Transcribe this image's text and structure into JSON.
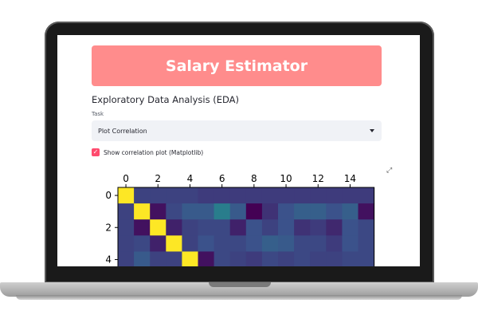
{
  "app": {
    "header_title": "Salary Estimator",
    "section_title": "Exploratory Data Analysis (EDA)",
    "task_label": "Task",
    "task_selected": "Plot Correlation",
    "checkbox_label": "Show correlation plot (Matplotlib)",
    "checkbox_checked": true,
    "colors": {
      "header": "#ff8c8c",
      "checkbox": "#ff4b6e",
      "select_bg": "#f0f2f6"
    },
    "icons": {
      "expand": "expand-icon",
      "caret": "chevron-down-icon",
      "check": "check-icon"
    }
  },
  "chart_data": {
    "type": "heatmap",
    "x_ticks": [
      "0",
      "2",
      "4",
      "6",
      "8",
      "10",
      "12",
      "14"
    ],
    "y_ticks": [
      "0",
      "2",
      "4"
    ],
    "x_range": [
      0,
      15
    ],
    "visible_rows": [
      0,
      1,
      2,
      3,
      4
    ],
    "colormap": "viridis",
    "matrix": [
      [
        1.0,
        0.2,
        0.2,
        0.2,
        0.2,
        0.18,
        0.18,
        0.18,
        0.18,
        0.18,
        0.18,
        0.18,
        0.18,
        0.18,
        0.18,
        0.18
      ],
      [
        0.2,
        1.0,
        0.05,
        0.22,
        0.28,
        0.28,
        0.42,
        0.28,
        0.0,
        0.15,
        0.25,
        0.3,
        0.3,
        0.25,
        0.3,
        0.05
      ],
      [
        0.2,
        0.05,
        1.0,
        0.1,
        0.2,
        0.22,
        0.22,
        0.1,
        0.25,
        0.2,
        0.25,
        0.15,
        0.18,
        0.12,
        0.25,
        0.22
      ],
      [
        0.2,
        0.22,
        0.1,
        1.0,
        0.2,
        0.25,
        0.22,
        0.22,
        0.25,
        0.3,
        0.28,
        0.22,
        0.22,
        0.18,
        0.25,
        0.22
      ],
      [
        0.2,
        0.28,
        0.2,
        0.2,
        1.0,
        0.05,
        0.22,
        0.2,
        0.18,
        0.22,
        0.2,
        0.22,
        0.2,
        0.2,
        0.22,
        0.22
      ]
    ]
  }
}
